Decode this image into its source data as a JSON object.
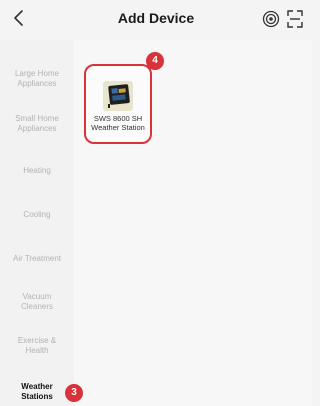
{
  "header": {
    "title": "Add Device"
  },
  "sidebar": {
    "categories": [
      {
        "label": "Large Home Appliances",
        "active": false
      },
      {
        "label": "Small Home Appliances",
        "active": false
      },
      {
        "label": "Heating",
        "active": false
      },
      {
        "label": "Cooling",
        "active": false
      },
      {
        "label": "Air Treatment",
        "active": false
      },
      {
        "label": "Vacuum Cleaners",
        "active": false
      },
      {
        "label": "Exercise & Health",
        "active": false
      },
      {
        "label": "Weather Stations",
        "active": true
      }
    ]
  },
  "device": {
    "name": "SWS 8600 SH Weather Station"
  },
  "badges": {
    "device_step": "4",
    "category_step": "3"
  },
  "colors": {
    "accent": "#d8323b",
    "muted_text": "#b3b3b3",
    "active_text": "#111111"
  }
}
